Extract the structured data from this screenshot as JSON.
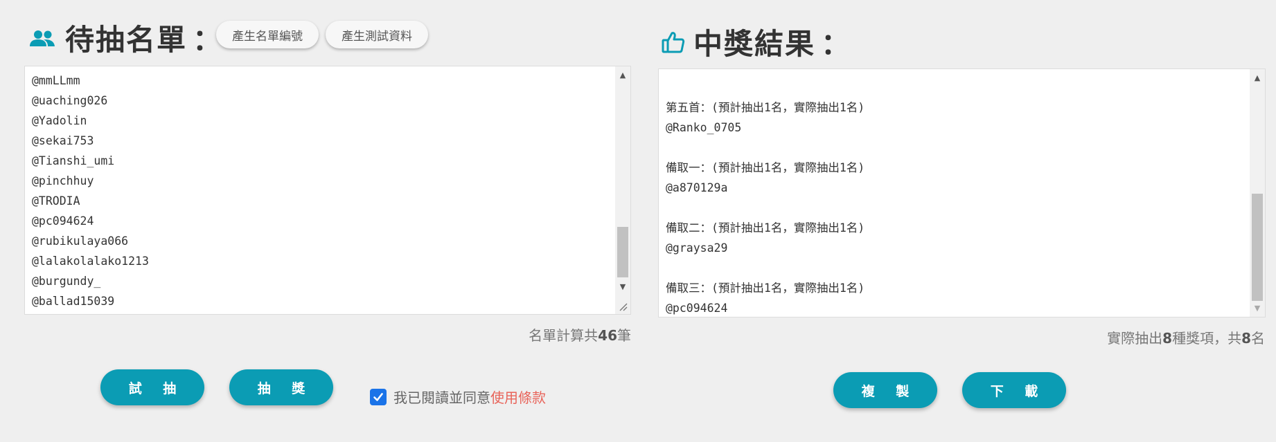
{
  "left": {
    "title": "待抽名單",
    "colon": "：",
    "generate_numbers_button": "產生名單編號",
    "generate_test_button": "產生測試資料",
    "names": [
      "@mmLLmm",
      "@uaching026",
      "@Yadolin",
      "@sekai753",
      "@Tianshi_umi",
      "@pinchhuy",
      "@TRODIA",
      "@pc094624",
      "@rubikulaya066",
      "@lalakolalako1213",
      "@burgundy_",
      "@ballad15039"
    ],
    "count_prefix": "名單計算共",
    "count_value": "46",
    "count_suffix": "筆",
    "trial_button": "試 抽",
    "draw_button": "抽 獎",
    "agree_text": "我已閱讀並同意",
    "terms_link": "使用條款",
    "agree_checked": true
  },
  "right": {
    "title": "中獎結果",
    "colon": "：",
    "results": [
      "",
      "第五首：(預計抽出1名，實際抽出1名)",
      "@Ranko_0705",
      "",
      "備取一：(預計抽出1名，實際抽出1名)",
      "@a870129a",
      "",
      "備取二：(預計抽出1名，實際抽出1名)",
      "@graysa29",
      "",
      "備取三：(預計抽出1名，實際抽出1名)",
      "@pc094624"
    ],
    "summary_prefix": "實際抽出",
    "summary_types": "8",
    "summary_mid": "種獎項，共",
    "summary_total": "8",
    "summary_suffix": "名",
    "copy_button": "複 製",
    "download_button": "下 載"
  },
  "colors": {
    "accent": "#0b9cb4",
    "link": "#e8645a",
    "checkbox": "#1a73e8",
    "background": "#efefef"
  },
  "icons": {
    "left_heading": "people-icon",
    "right_heading": "thumbs-up-icon"
  }
}
